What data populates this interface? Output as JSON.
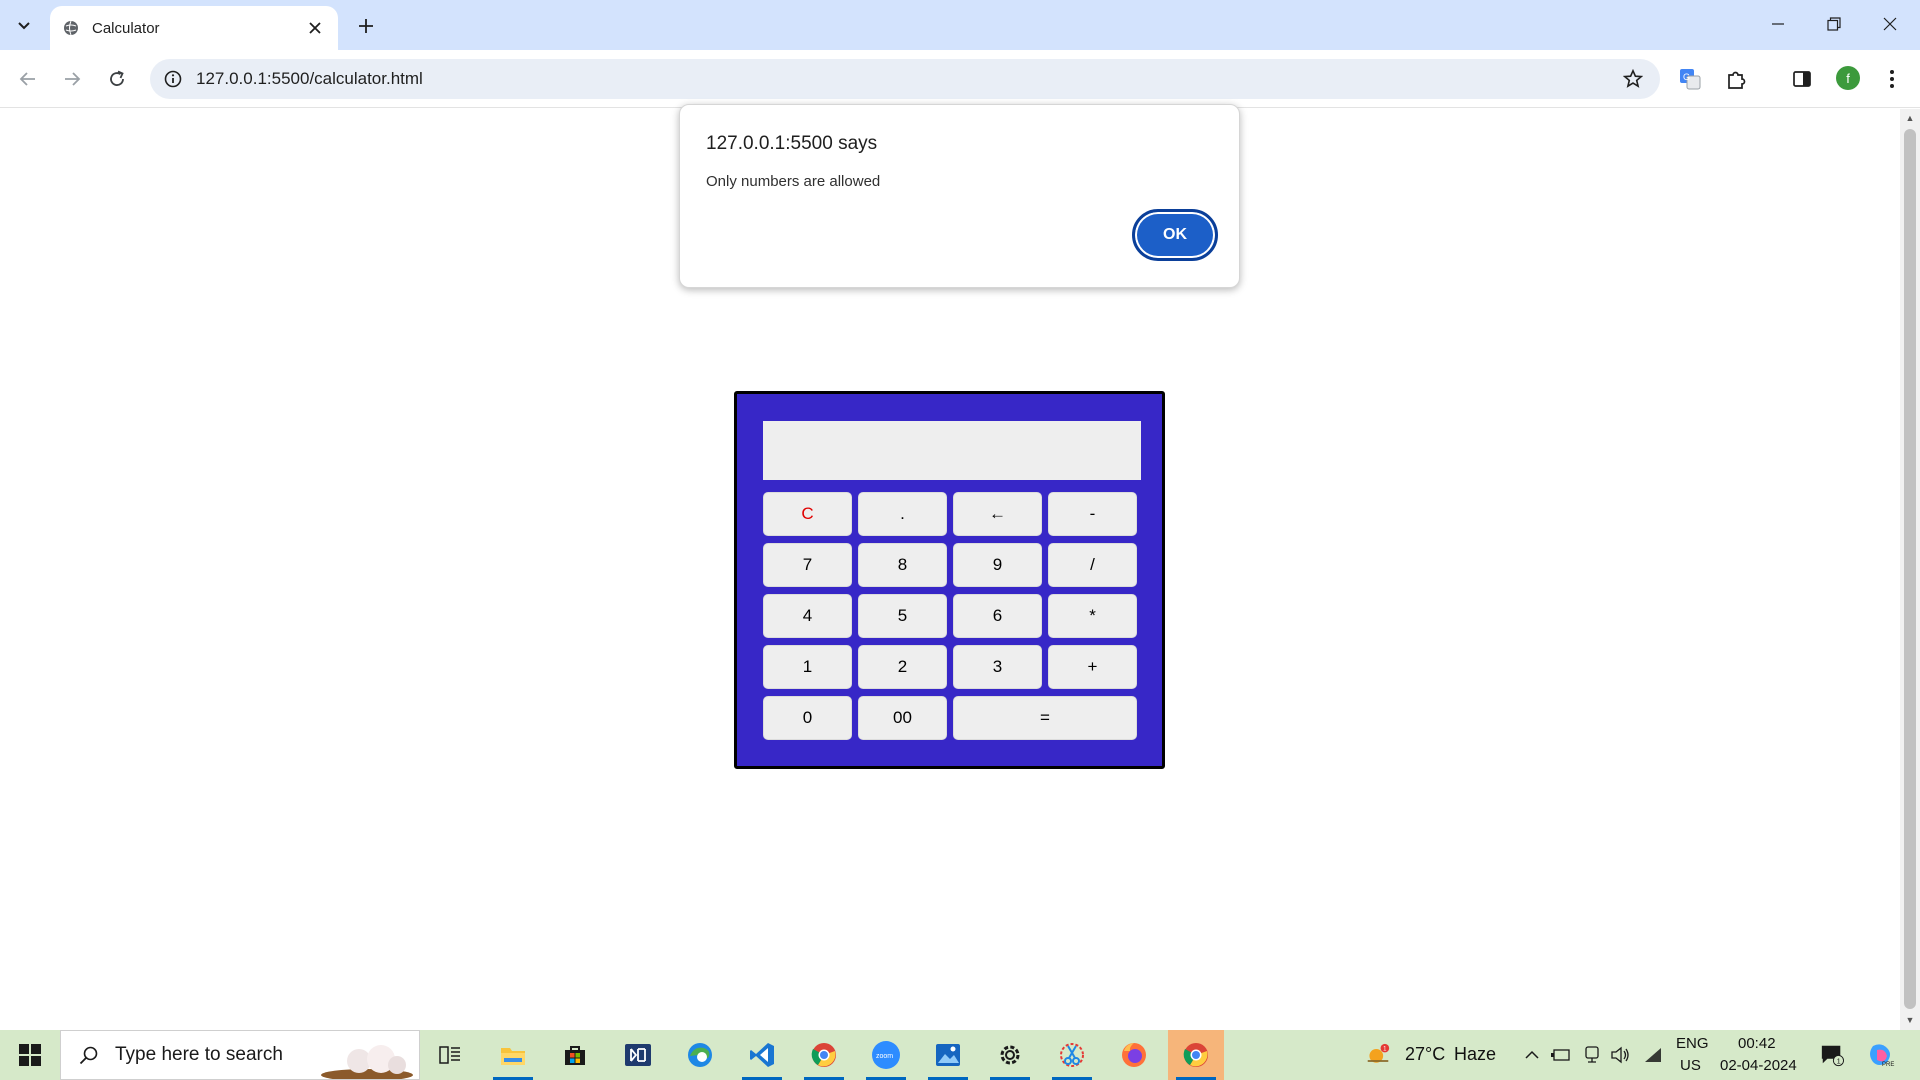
{
  "browser": {
    "tab": {
      "title": "Calculator"
    },
    "address": {
      "url": "127.0.0.1:5500/calculator.html"
    },
    "profile_initial": "f"
  },
  "dialog": {
    "title": "127.0.0.1:5500 says",
    "message": "Only numbers are allowed",
    "ok_label": "OK"
  },
  "calculator": {
    "display_value": "",
    "rows": [
      [
        "C",
        ".",
        "←",
        "-"
      ],
      [
        "7",
        "8",
        "9",
        "/"
      ],
      [
        "4",
        "5",
        "6",
        "*"
      ],
      [
        "1",
        "2",
        "3",
        "+"
      ],
      [
        "0",
        "00",
        "="
      ]
    ],
    "colors": {
      "body": "#3727c7",
      "key": "#eeeeee",
      "clear_text": "#e00000"
    }
  },
  "taskbar": {
    "search_placeholder": "Type here to search",
    "weather": {
      "temp": "27°C",
      "condition": "Haze",
      "badge": "1"
    },
    "language": {
      "lang": "ENG",
      "region": "US"
    },
    "clock": {
      "time": "00:42",
      "date": "02-04-2024"
    },
    "notification_count": "1",
    "apps": [
      "task-view",
      "file-explorer",
      "microsoft-store",
      "dell-app",
      "edge",
      "vscode",
      "chrome",
      "zoom",
      "photos",
      "settings",
      "snipping-tool",
      "firefox",
      "chrome-active"
    ]
  }
}
